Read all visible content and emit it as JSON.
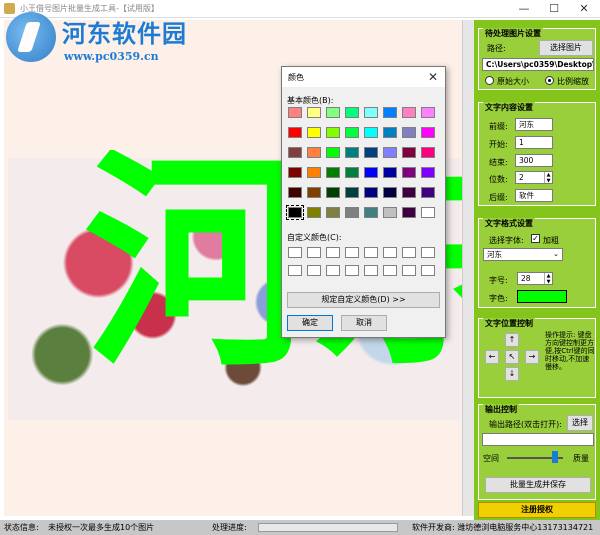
{
  "window": {
    "title": "小王借号图片批量生成工具-【试用版】",
    "minimize": "—",
    "maximize": "☐",
    "close": "✕"
  },
  "watermark": {
    "brand": "河东软件园",
    "site": "www.pc0359.cn"
  },
  "canvas": {
    "overlay_text": "河东",
    "overlay_color": "#00ff00"
  },
  "panel": {
    "source": {
      "title": "待处理图片设置",
      "path_label": "路径:",
      "select_button": "选择图片",
      "path_value": "C:\\Users\\pc0359\\Desktop\\",
      "mode_original": "原始大小",
      "mode_ratio": "比例缩放",
      "selected_mode": "比例缩放"
    },
    "content": {
      "title": "文字内容设置",
      "prefix_label": "前缀:",
      "prefix_value": "河东",
      "start_label": "开始:",
      "start_value": "1",
      "end_label": "结束:",
      "end_value": "300",
      "digits_label": "位数:",
      "digits_value": "2",
      "suffix_label": "后缀:",
      "suffix_value": "软件"
    },
    "format": {
      "title": "文字格式设置",
      "font_label": "选择字体:",
      "bold_label": "加粗",
      "bold_checked": "✓",
      "font_value": "河东",
      "size_label": "字号:",
      "size_value": "28",
      "color_label": "字色:",
      "color_value": "#00ff00"
    },
    "position": {
      "title": "文字位置控制",
      "up": "↑",
      "left": "←",
      "center": "↖",
      "right": "→",
      "down": "↓",
      "hint": "操作提示: 键盘方向键控制更方便,按Ctrl键的同时移动,不加速慢移。"
    },
    "output": {
      "title": "输出控制",
      "path_label": "输出路径(双击打开):",
      "select_button": "选择",
      "path_value": "",
      "space_label": "空间",
      "quality_label": "质量",
      "quality_level": 0.85,
      "generate_button": "批量生成并保存",
      "register_button": "注册授权"
    }
  },
  "status": {
    "info_label": "状态信息:",
    "info_value": "未授权一次最多生成10个图片",
    "progress_label": "处理进度:",
    "developer": "软件开发商: 潍坊德浏电脑服务中心13173134721"
  },
  "color_dialog": {
    "title": "颜色",
    "basic_label": "基本颜色(B):",
    "custom_label": "自定义颜色(C):",
    "define_button": "规定自定义颜色(D) >>",
    "ok_button": "确定",
    "cancel_button": "取消",
    "close": "✕",
    "basic_colors": [
      "#ff8080",
      "#ffff80",
      "#80ff80",
      "#00ff80",
      "#80ffff",
      "#0080ff",
      "#ff80c0",
      "#ff80ff",
      "#ff0000",
      "#ffff00",
      "#80ff00",
      "#00ff40",
      "#00ffff",
      "#0080c0",
      "#8080c0",
      "#ff00ff",
      "#804040",
      "#ff8040",
      "#00ff00",
      "#008080",
      "#004080",
      "#8080ff",
      "#800040",
      "#ff0080",
      "#800000",
      "#ff8000",
      "#008000",
      "#008040",
      "#0000ff",
      "#0000a0",
      "#800080",
      "#8000ff",
      "#400000",
      "#804000",
      "#004000",
      "#004040",
      "#000080",
      "#000040",
      "#400040",
      "#400080",
      "#000000",
      "#808000",
      "#808040",
      "#808080",
      "#408080",
      "#c0c0c0",
      "#400040",
      "#ffffff"
    ],
    "selected_index": 40
  }
}
